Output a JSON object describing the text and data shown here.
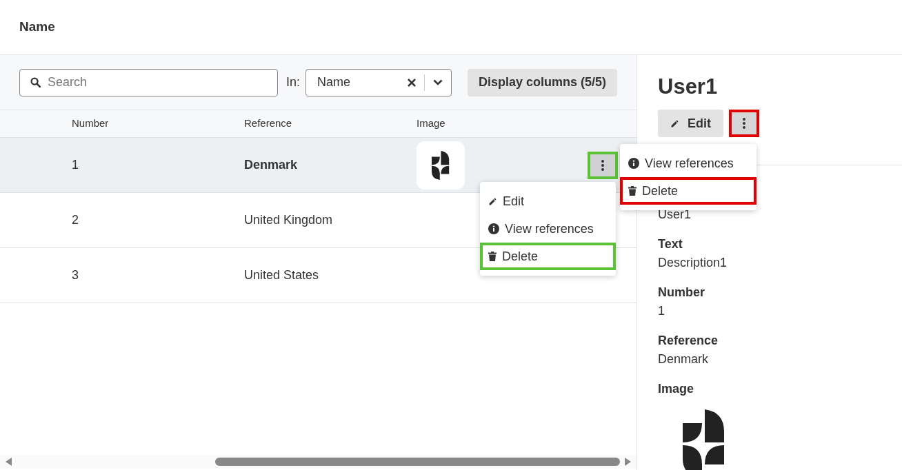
{
  "header": {
    "title": "Name"
  },
  "toolbar": {
    "search": {
      "placeholder": "Search"
    },
    "in_label": "In:",
    "filter": {
      "value": "Name"
    },
    "columns_button": "Display columns (5/5)"
  },
  "table": {
    "columns": [
      "Number",
      "Reference",
      "Image"
    ],
    "rows": [
      {
        "number": "1",
        "reference": "Denmark",
        "has_image": true,
        "selected": true
      },
      {
        "number": "2",
        "reference": "United Kingdom",
        "has_image": false,
        "selected": false
      },
      {
        "number": "3",
        "reference": "United States",
        "has_image": false,
        "selected": false
      }
    ]
  },
  "row_menu": {
    "color": "#5bc236",
    "button_highlighted": true,
    "items": [
      {
        "kind": "edit",
        "label": "Edit",
        "highlighted": false
      },
      {
        "kind": "info",
        "label": "View references",
        "highlighted": false
      },
      {
        "kind": "delete",
        "label": "Delete",
        "highlighted": true
      }
    ]
  },
  "detail": {
    "title": "User1",
    "edit_button": "Edit",
    "menu": {
      "color": "#e00000",
      "button_highlighted": true,
      "items": [
        {
          "kind": "info",
          "label": "View references",
          "highlighted": false
        },
        {
          "kind": "delete",
          "label": "Delete",
          "highlighted": true
        }
      ]
    },
    "fields": [
      {
        "kind": "text",
        "value": "User1"
      },
      {
        "kind": "text",
        "label": "Text",
        "value": "Description1"
      },
      {
        "kind": "text",
        "label": "Number",
        "value": "1"
      },
      {
        "kind": "text",
        "label": "Reference",
        "value": "Denmark"
      },
      {
        "kind": "image",
        "label": "Image"
      }
    ]
  }
}
